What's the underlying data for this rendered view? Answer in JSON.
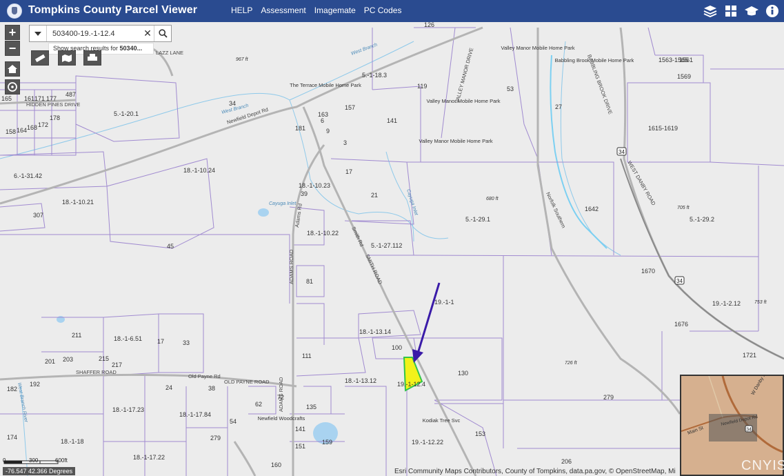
{
  "header": {
    "title": "Tompkins County Parcel Viewer",
    "nav": [
      "HELP",
      "Assessment",
      "Imagemate",
      "PC Codes"
    ],
    "icons": [
      "layers-icon",
      "grid-icon",
      "graduation-cap-icon",
      "info-icon"
    ]
  },
  "search": {
    "value": "503400-19.-1-12.4",
    "suggestion_prefix": "Show search results for ",
    "suggestion_bold": "50340..."
  },
  "controls": {
    "zoom_in": "+",
    "zoom_out": "−"
  },
  "map": {
    "road_labels": [
      "Newfield Depot Rd",
      "ADAMS ROAD",
      "Adams Rd",
      "Smith Rd",
      "SMITH ROAD",
      "SHAFFER ROAD",
      "OLD PAYNE ROAD",
      "Old Payne Rd",
      "HIDDEN PINES DRIVE",
      "BABBLING BROOK DRIVE",
      "WEST DANBY ROAD",
      "Norfolk Southern",
      "ADAMS ROAD",
      "VALLEY MANOR DRIVE",
      "LAZZ LANE"
    ],
    "water_labels": [
      "West Branch",
      "West Branch",
      "Cayuga Inlet",
      "Cayuga Inlet",
      "West Branch River"
    ],
    "place_labels": [
      "The Terrace Mobile Home Park",
      "Valley Manor Mobile Home Park",
      "Valley Manor Mobile Home Park",
      "Valley Manor Mobile Home Park",
      "Babbling Brook Mobile Home Park",
      "Newfield Woodcrafts",
      "Kodiak Tree Svc"
    ],
    "elevations": [
      "967 ft",
      "680 ft",
      "705 ft",
      "753 ft",
      "726 ft"
    ],
    "parcels": [
      "5.-1-18.3",
      "5.-1-20.1",
      "6.-1-31.42",
      "18.-1-10.24",
      "18.-1-10.21",
      "18.-1-10.23",
      "18.-1-10.22",
      "5.-1-27.112",
      "5.-1-29.1",
      "5.-1-29.2",
      "1642",
      "1670",
      "1676",
      "19.-1-2.12",
      "19.-1-1",
      "18.-1-13.14",
      "18.-1-13.12",
      "19.-1-12.4",
      "19.-1-12.22",
      "130",
      "153",
      "279",
      "206",
      "1721",
      "18.-1-6.51",
      "18.-1-17.23",
      "18.-1-17.84",
      "18.-1-18",
      "18.-1-17.22",
      "1615-1619",
      "1563-1565",
      "1561",
      "1569",
      "126",
      "34",
      "487",
      "165",
      "161",
      "171",
      "177",
      "178",
      "158",
      "164",
      "168",
      "172",
      "181",
      "163",
      "157",
      "119",
      "141",
      "53",
      "27",
      "6",
      "9",
      "3",
      "17",
      "21",
      "307",
      "45",
      "81",
      "111",
      "100",
      "211",
      "201",
      "203",
      "215",
      "217",
      "17",
      "33",
      "192",
      "182",
      "174",
      "24",
      "38",
      "54",
      "62",
      "72",
      "279",
      "135",
      "141",
      "151",
      "159",
      "160",
      "39"
    ],
    "highlighted_parcel": "19.-1-12.4",
    "route_shield": "34",
    "colors": {
      "background": "#ececec",
      "parcel_line": "#a08ad0",
      "road": "#b4b4b4",
      "highlight_fill": "#f2f21a",
      "highlight_stroke": "#31c44a",
      "arrow": "#3a1ba8",
      "water": "#a9d3f0",
      "stream": "#8ec9ea"
    }
  },
  "scale": {
    "ticks": [
      "0",
      "300",
      "600ft"
    ]
  },
  "coordinates": "-76.547 42.366 Degrees",
  "attribution": "Esri Community Maps Contributors, County of Tompkins, data.pa.gov, © OpenStreetMap, Mi",
  "inset": {
    "labels": [
      "W Danby Rd",
      "Newfield Depot Rd",
      "Main St"
    ],
    "shield": "34"
  },
  "watermark": "CNYIS"
}
